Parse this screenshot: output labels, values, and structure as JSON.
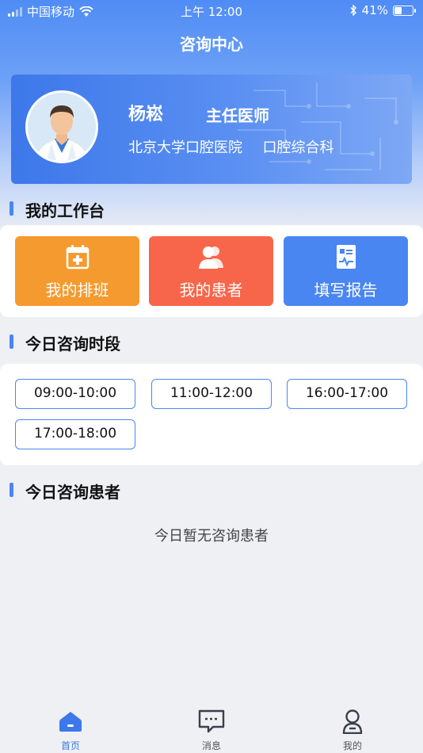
{
  "status_bar": {
    "carrier": "中国移动",
    "time": "上午 12:00",
    "battery": "41%"
  },
  "header": {
    "title": "咨询中心"
  },
  "profile": {
    "name": "杨崧",
    "title": "主任医师",
    "hospital": "北京大学口腔医院",
    "department": "口腔综合科"
  },
  "workbench": {
    "title": "我的工作台",
    "tiles": [
      {
        "label": "我的排班",
        "icon": "calendar-icon",
        "color": "#f59a2e"
      },
      {
        "label": "我的患者",
        "icon": "patients-icon",
        "color": "#f7664a"
      },
      {
        "label": "填写报告",
        "icon": "report-icon",
        "color": "#4a86f2"
      }
    ]
  },
  "slots": {
    "title": "今日咨询时段",
    "items": [
      "09:00-10:00",
      "11:00-12:00",
      "16:00-17:00",
      "17:00-18:00"
    ]
  },
  "patients": {
    "title": "今日咨询患者",
    "empty": "今日暂无咨询患者"
  },
  "tabbar": {
    "items": [
      {
        "label": "首页",
        "icon": "home-icon",
        "active": true
      },
      {
        "label": "消息",
        "icon": "message-icon",
        "active": false
      },
      {
        "label": "我的",
        "icon": "profile-icon",
        "active": false
      }
    ]
  },
  "colors": {
    "accent": "#3d78ea"
  }
}
